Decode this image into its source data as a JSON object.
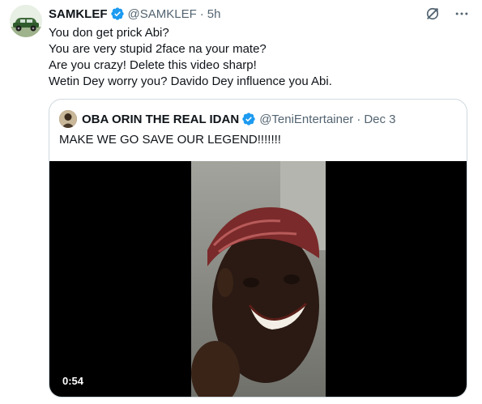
{
  "tweet": {
    "author": {
      "display_name": "SAMKLEF",
      "handle": "@SAMKLEF",
      "time": "5h",
      "verified": true,
      "avatar": "vintage-car-avatar"
    },
    "separator": "·",
    "body_lines": [
      "You don get prick Abi?",
      "You are very stupid 2face na your mate?",
      "Are you crazy! Delete this video sharp!",
      "Wetin Dey worry you? Davido Dey influence you Abi."
    ],
    "actions": {
      "grok_icon": "grok-icon",
      "more_icon": "more-options-icon"
    }
  },
  "quoted_tweet": {
    "author": {
      "display_name": "OBA ORIN THE REAL IDAN",
      "handle": "@TeniEntertainer",
      "time": "Dec 3",
      "verified": true
    },
    "separator": "·",
    "text": "MAKE WE GO SAVE OUR LEGEND!!!!!!!",
    "video": {
      "duration": "0:54"
    }
  },
  "colors": {
    "text_primary": "#0f1419",
    "text_secondary": "#536471",
    "verified_blue": "#1d9bf0",
    "border": "#cfd9de"
  }
}
